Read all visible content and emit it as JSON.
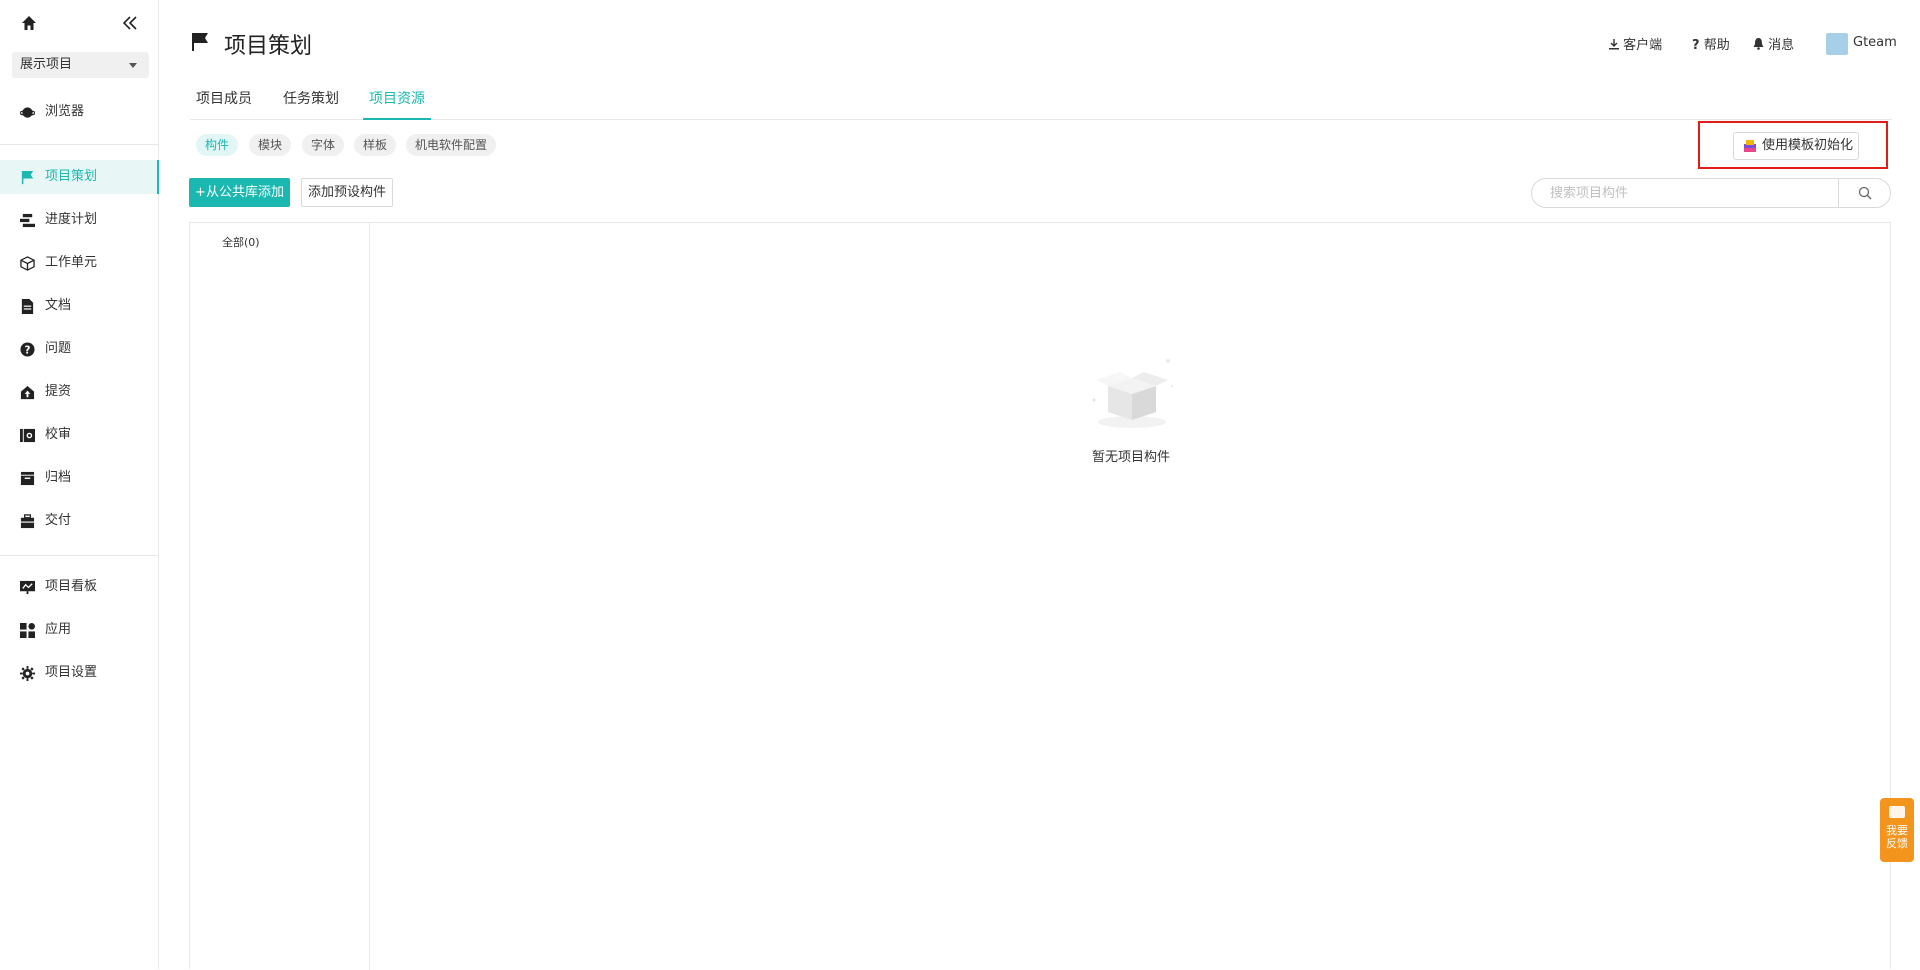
{
  "sidebar": {
    "project_select": "展示项目",
    "items": [
      {
        "label": "浏览器"
      },
      {
        "label": "项目策划"
      },
      {
        "label": "进度计划"
      },
      {
        "label": "工作单元"
      },
      {
        "label": "文档"
      },
      {
        "label": "问题"
      },
      {
        "label": "提资"
      },
      {
        "label": "校审"
      },
      {
        "label": "归档"
      },
      {
        "label": "交付"
      },
      {
        "label": "项目看板"
      },
      {
        "label": "应用"
      },
      {
        "label": "项目设置"
      }
    ]
  },
  "header": {
    "title": "项目策划",
    "client": "客户端",
    "help": "帮助",
    "messages": "消息",
    "user": "Gteam"
  },
  "tabs": [
    {
      "label": "项目成员"
    },
    {
      "label": "任务策划"
    },
    {
      "label": "项目资源"
    }
  ],
  "chips": [
    {
      "label": "构件"
    },
    {
      "label": "模块"
    },
    {
      "label": "字体"
    },
    {
      "label": "样板"
    },
    {
      "label": "机电软件配置"
    }
  ],
  "toolbar": {
    "init_template": "使用模板初始化",
    "add_from_public": "+从公共库添加",
    "add_preset": "添加预设构件",
    "search_placeholder": "搜索项目构件"
  },
  "categories": {
    "all": "全部(0)"
  },
  "empty_state": {
    "text": "暂无项目构件"
  },
  "feedback": {
    "line1": "我要",
    "line2": "反馈"
  },
  "colors": {
    "accent": "#1ab8b0",
    "highlight_border": "#e21b1b",
    "feedback": "#f3941d"
  }
}
